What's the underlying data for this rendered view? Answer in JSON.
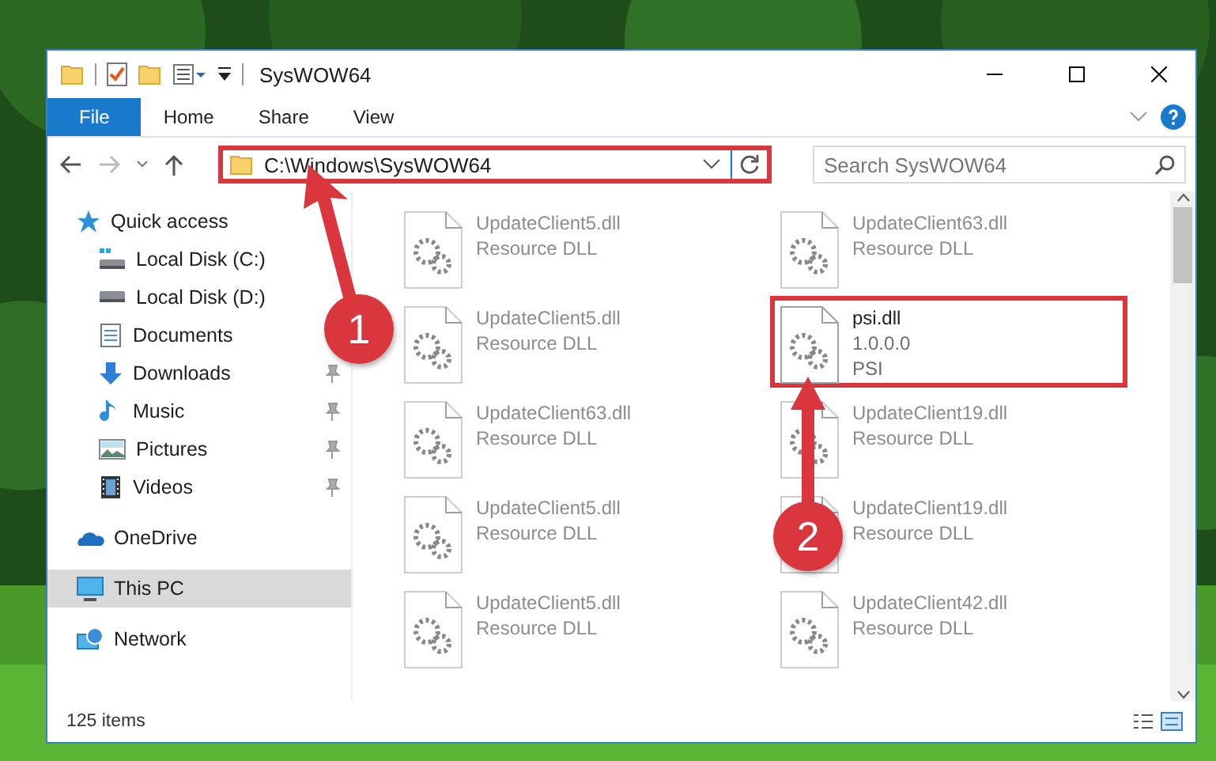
{
  "window": {
    "title": "SysWOW64"
  },
  "ribbon": {
    "tabs": [
      {
        "label": "File",
        "selected": true
      },
      {
        "label": "Home",
        "selected": false
      },
      {
        "label": "Share",
        "selected": false
      },
      {
        "label": "View",
        "selected": false
      }
    ]
  },
  "address": {
    "path": "C:\\Windows\\SysWOW64",
    "highlighted": true
  },
  "search": {
    "placeholder": "Search SysWOW64"
  },
  "sidebar": {
    "items": [
      {
        "label": "Quick access",
        "kind": "star",
        "selected": false,
        "children": [
          {
            "label": "Local Disk (C:)",
            "kind": "system-drive",
            "pinned": false,
            "selected": false
          },
          {
            "label": "Local Disk (D:)",
            "kind": "drive",
            "pinned": false,
            "selected": false
          },
          {
            "label": "Documents",
            "kind": "documents",
            "pinned": false,
            "selected": false
          },
          {
            "label": "Downloads",
            "kind": "downloads",
            "pinned": true,
            "selected": false
          },
          {
            "label": "Music",
            "kind": "music",
            "pinned": true,
            "selected": false
          },
          {
            "label": "Pictures",
            "kind": "pictures",
            "pinned": true,
            "selected": false
          },
          {
            "label": "Videos",
            "kind": "videos",
            "pinned": true,
            "selected": false
          }
        ]
      },
      {
        "label": "OneDrive",
        "kind": "cloud",
        "selected": false
      },
      {
        "label": "This PC",
        "kind": "computer",
        "selected": true
      },
      {
        "label": "Network",
        "kind": "network",
        "selected": false
      }
    ]
  },
  "files": [
    {
      "name": "UpdateClient5.dll",
      "lines": [
        "Resource DLL"
      ],
      "blurred": true,
      "highlighted": false
    },
    {
      "name": "UpdateClient63.dll",
      "lines": [
        "Resource DLL"
      ],
      "blurred": true,
      "highlighted": false
    },
    {
      "name": "UpdateClient5.dll",
      "lines": [
        "Resource DLL"
      ],
      "blurred": true,
      "highlighted": false
    },
    {
      "name": "psi.dll",
      "lines": [
        "1.0.0.0",
        "PSI"
      ],
      "blurred": false,
      "highlighted": true
    },
    {
      "name": "UpdateClient63.dll",
      "lines": [
        "Resource DLL"
      ],
      "blurred": true,
      "highlighted": false
    },
    {
      "name": "UpdateClient19.dll",
      "lines": [
        "Resource DLL"
      ],
      "blurred": true,
      "highlighted": false
    },
    {
      "name": "UpdateClient5.dll",
      "lines": [
        "Resource DLL"
      ],
      "blurred": true,
      "highlighted": false
    },
    {
      "name": "UpdateClient19.dll",
      "lines": [
        "Resource DLL"
      ],
      "blurred": true,
      "highlighted": false
    },
    {
      "name": "UpdateClient5.dll",
      "lines": [
        "Resource DLL"
      ],
      "blurred": true,
      "highlighted": false
    },
    {
      "name": "UpdateClient42.dll",
      "lines": [
        "Resource DLL"
      ],
      "blurred": true,
      "highlighted": false
    }
  ],
  "status_bar": {
    "count": "125 items"
  },
  "callouts": [
    {
      "number": "1"
    },
    {
      "number": "2"
    }
  ]
}
